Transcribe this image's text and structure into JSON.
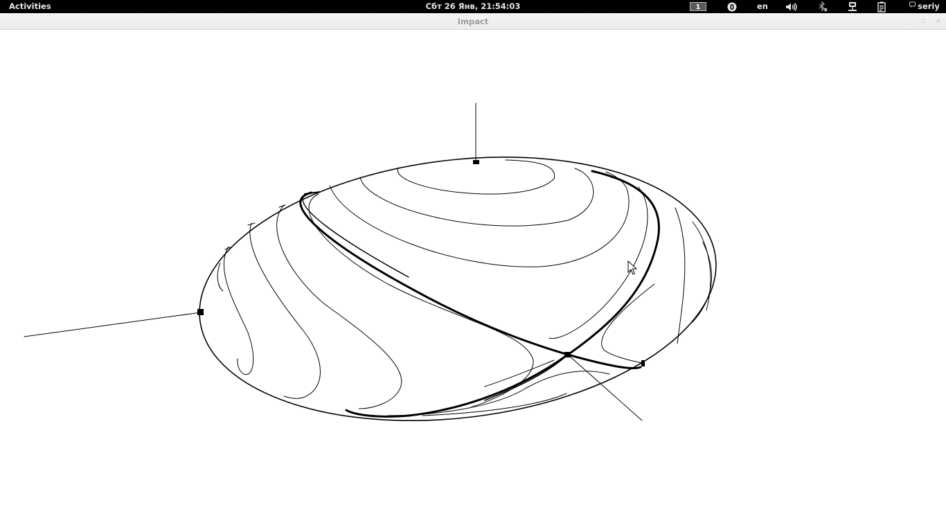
{
  "topbar": {
    "activities_label": "Activities",
    "clock": "Сбт 26 Янв, 21:54:03",
    "workspace": "1",
    "keyboard_layout": "en",
    "user_name": "seriy",
    "tray_icons": [
      "notification-icon",
      "volume-icon",
      "bluetooth-disabled-icon",
      "network-wired-icon",
      "battery-icon",
      "user-status-icon"
    ]
  },
  "window": {
    "title": "Impact",
    "buttons": [
      "minimize-icon",
      "maximize-icon",
      "close-icon"
    ],
    "background": "#ffffff"
  },
  "scene": {
    "stroke_color": "#000000",
    "description_items": [
      "ellipsoid-surface",
      "contour-lines",
      "thick-boundary-curves",
      "axis-lines",
      "marker-squares",
      "mouse-pointer"
    ]
  }
}
